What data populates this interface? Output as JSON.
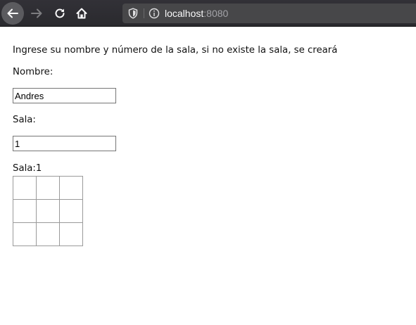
{
  "browser": {
    "url_host": "localhost",
    "url_port": ":8080",
    "icons": {
      "back": "back-arrow-icon",
      "forward": "forward-arrow-icon",
      "reload": "reload-icon",
      "home": "home-icon",
      "tracking": "shield-icon",
      "site_info": "info-icon"
    },
    "colors": {
      "toolbar": "#2a2a2e",
      "urlbar": "#474749",
      "active_button": "#5b5b5f"
    }
  },
  "page": {
    "intro": "Ingrese su nombre y número de la sala, si no existe la sala, se creará",
    "nombre_label": "Nombre:",
    "nombre_value": "Andres",
    "sala_label": "Sala:",
    "sala_value": "1",
    "sala_current_label": "Sala:1",
    "board": [
      [
        "",
        "",
        ""
      ],
      [
        "",
        "",
        ""
      ],
      [
        "",
        "",
        ""
      ]
    ]
  }
}
